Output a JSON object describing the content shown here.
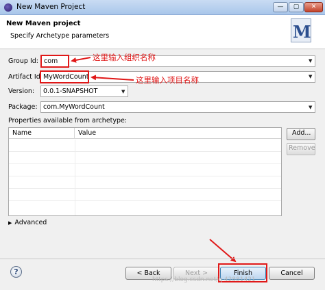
{
  "window": {
    "title": "New Maven Project",
    "min_glyph": "—",
    "max_glyph": "▢",
    "close_glyph": "✕"
  },
  "header": {
    "title": "New Maven project",
    "description": "Specify Archetype parameters",
    "logo_letter": "M"
  },
  "form": {
    "group_id_label": "Group Id:",
    "group_id_value": "com",
    "artifact_id_label": "Artifact Id:",
    "artifact_id_value": "MyWordCount",
    "version_label": "Version:",
    "version_value": "0.0.1-SNAPSHOT",
    "package_label": "Package:",
    "package_value": "com.MyWordCount"
  },
  "properties": {
    "label": "Properties available from archetype:",
    "columns": [
      "Name",
      "Value"
    ],
    "add_button": "Add...",
    "remove_button": "Remove"
  },
  "advanced_label": "Advanced",
  "annotations": {
    "group_note": "这里输入组织名称",
    "artifact_note": "这里输入项目名称",
    "color": "#e01818"
  },
  "footer": {
    "help_glyph": "?",
    "back_button": "< Back",
    "next_button": "Next >",
    "finish_button": "Finish",
    "cancel_button": "Cancel"
  },
  "watermark": "https://blog.csdn.net/q 42881421"
}
